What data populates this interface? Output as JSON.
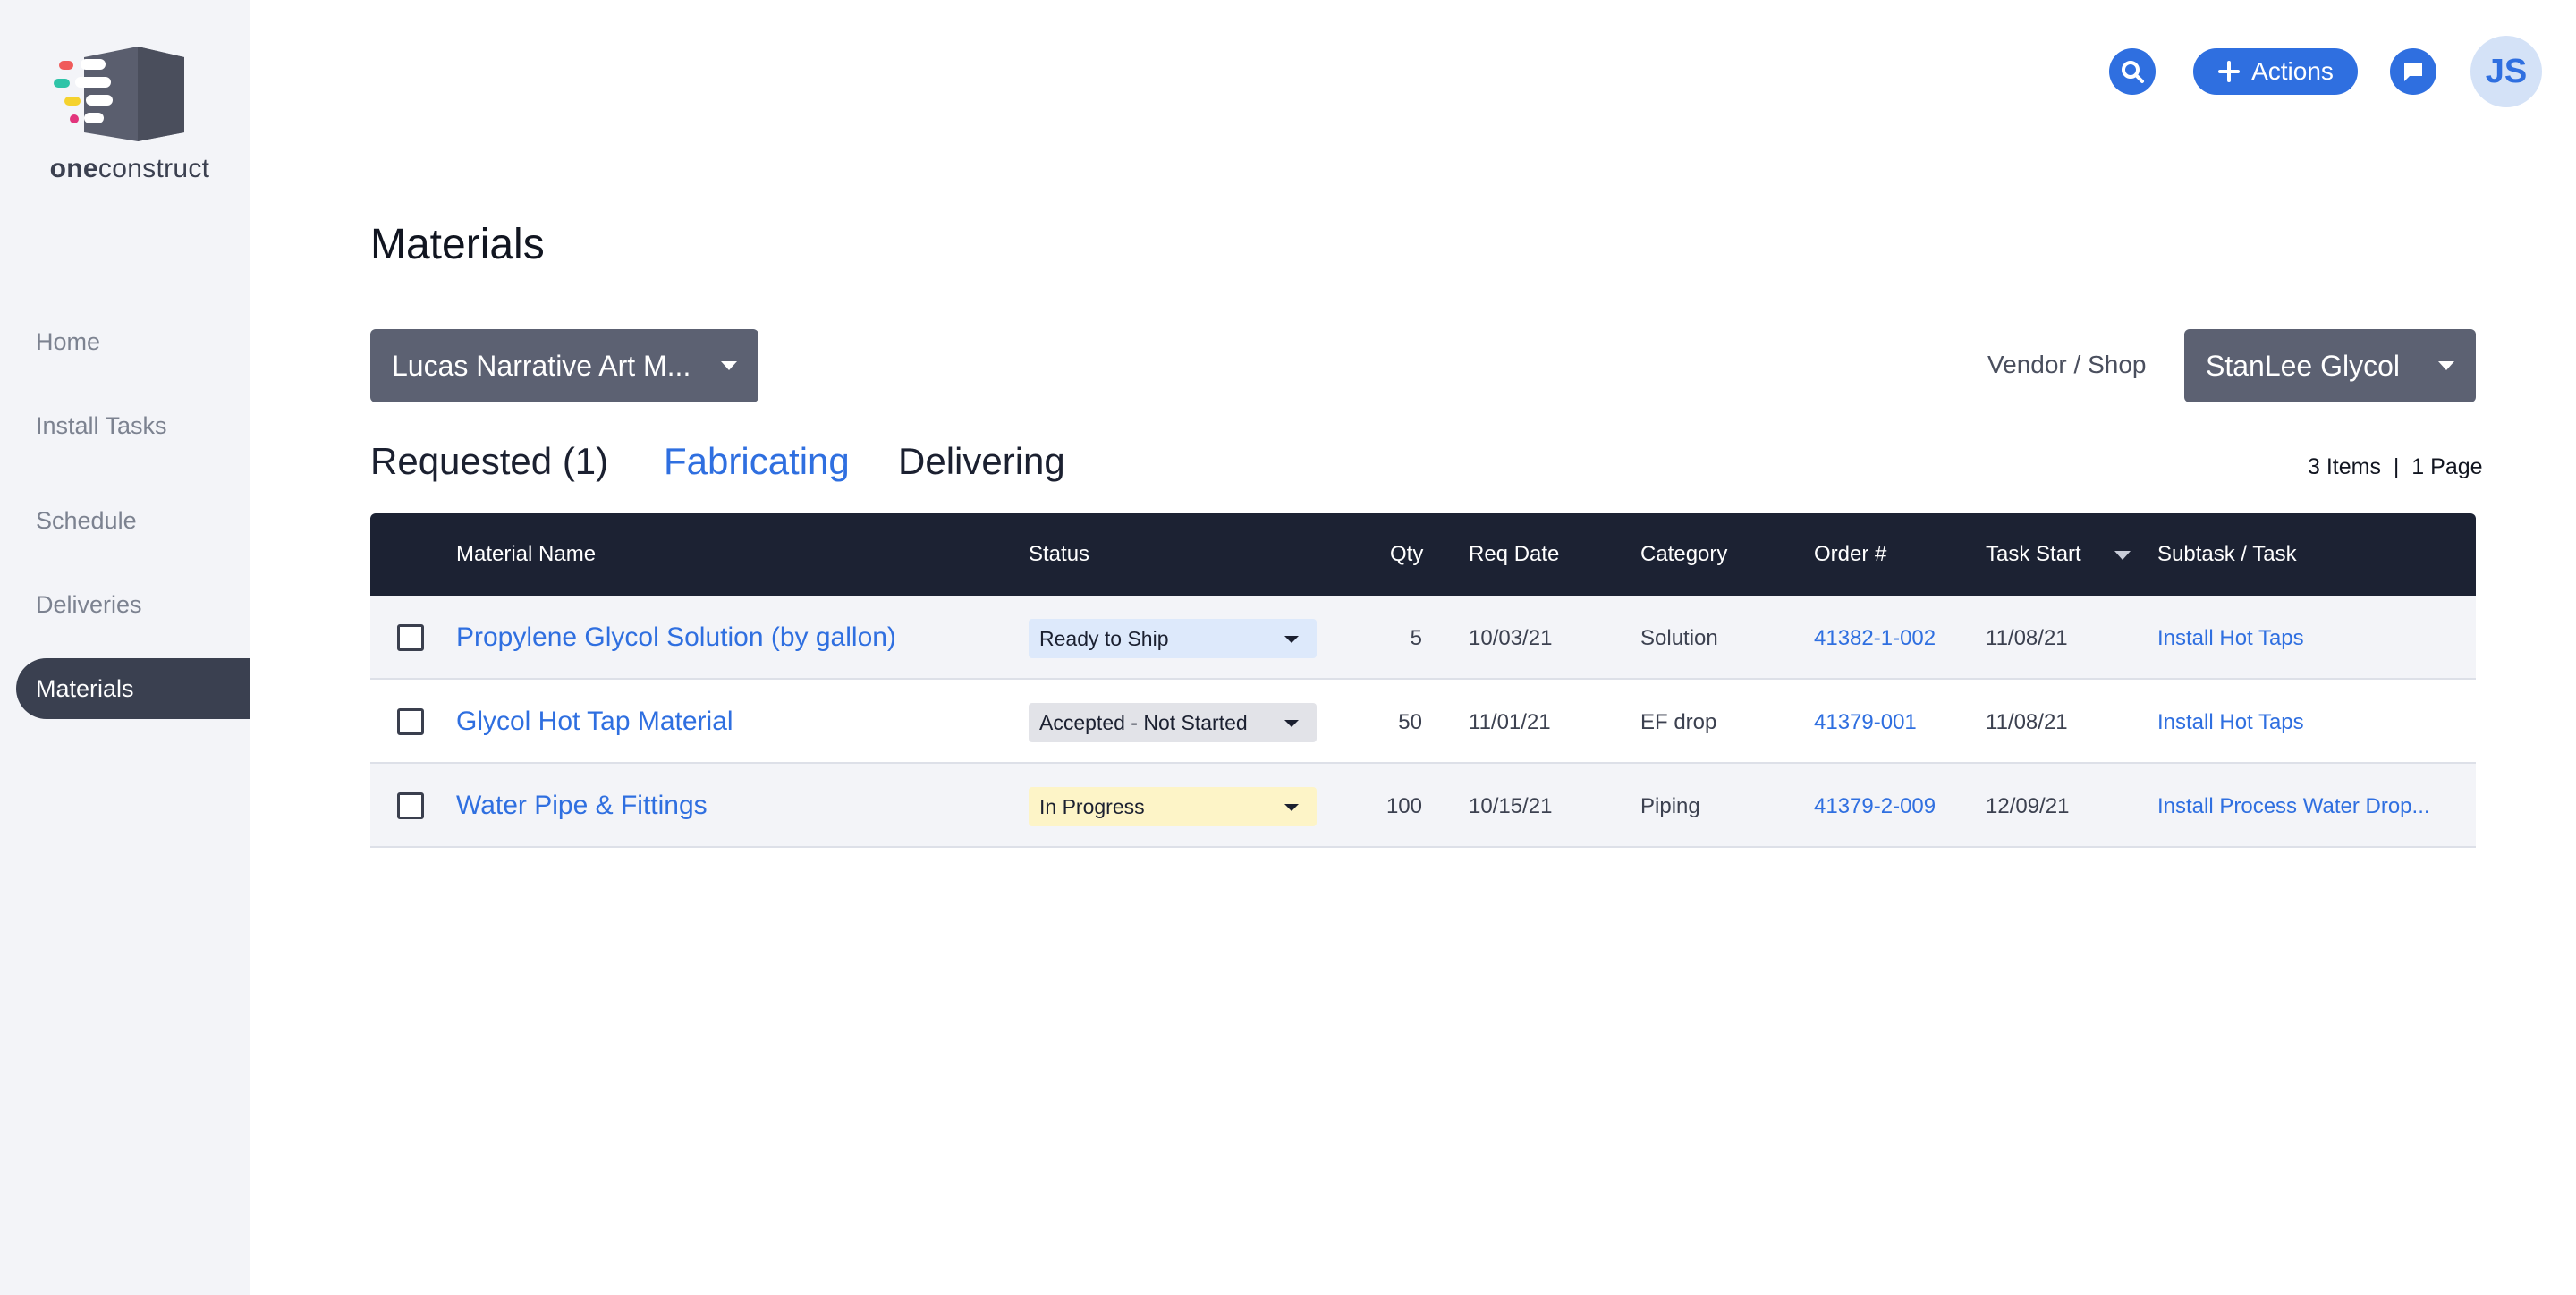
{
  "logo": {
    "text_bold": "one",
    "text_regular": "construct"
  },
  "sidebar": {
    "items": [
      {
        "label": "Home",
        "active": false
      },
      {
        "label": "Install Tasks",
        "active": false
      },
      {
        "label": "Schedule",
        "active": false
      },
      {
        "label": "Deliveries",
        "active": false
      },
      {
        "label": "Materials",
        "active": true
      }
    ]
  },
  "topbar": {
    "search_icon": "search-icon",
    "actions_label": "Actions",
    "chat_icon": "chat-icon",
    "avatar_initials": "JS"
  },
  "page": {
    "title": "Materials",
    "project_dropdown": "Lucas Narrative Art M...",
    "vendor_label": "Vendor / Shop",
    "vendor_dropdown": "StanLee Glycol"
  },
  "tabs": [
    {
      "label": "Requested (1)",
      "active": false
    },
    {
      "label": "Fabricating",
      "active": true
    },
    {
      "label": "Delivering",
      "active": false
    }
  ],
  "pager": {
    "items": "3 Items",
    "separator": "|",
    "pages": "1 Page"
  },
  "table": {
    "columns": [
      "Material Name",
      "Status",
      "Qty",
      "Req Date",
      "Category",
      "Order #",
      "Task Start",
      "Subtask / Task"
    ],
    "sorted_column": "Task Start",
    "rows": [
      {
        "name": "Propylene Glycol Solution (by gallon)",
        "status": "Ready to Ship",
        "status_color": "#dde9fb",
        "qty": "5",
        "req_date": "10/03/21",
        "category": "Solution",
        "order": "41382-1-002",
        "task_start": "11/08/21",
        "subtask": "Install Hot Taps",
        "checked": false
      },
      {
        "name": "Glycol Hot Tap Material",
        "status": "Accepted - Not Started",
        "status_color": "#e2e3e8",
        "qty": "50",
        "req_date": "11/01/21",
        "category": "EF drop",
        "order": "41379-001",
        "task_start": "11/08/21",
        "subtask": "Install Hot Taps",
        "checked": false
      },
      {
        "name": "Water Pipe & Fittings",
        "status": "In Progress",
        "status_color": "#fdf4c7",
        "qty": "100",
        "req_date": "10/15/21",
        "category": "Piping",
        "order": "41379-2-009",
        "task_start": "12/09/21",
        "subtask": "Install Process Water Drop...",
        "checked": false
      }
    ]
  },
  "colors": {
    "accent": "#2f6fe0",
    "sidebar_bg": "#f3f4f8",
    "nav_active_bg": "#3a4050",
    "table_header_bg": "#1c2233",
    "dropdown_bg": "#5c6172"
  }
}
